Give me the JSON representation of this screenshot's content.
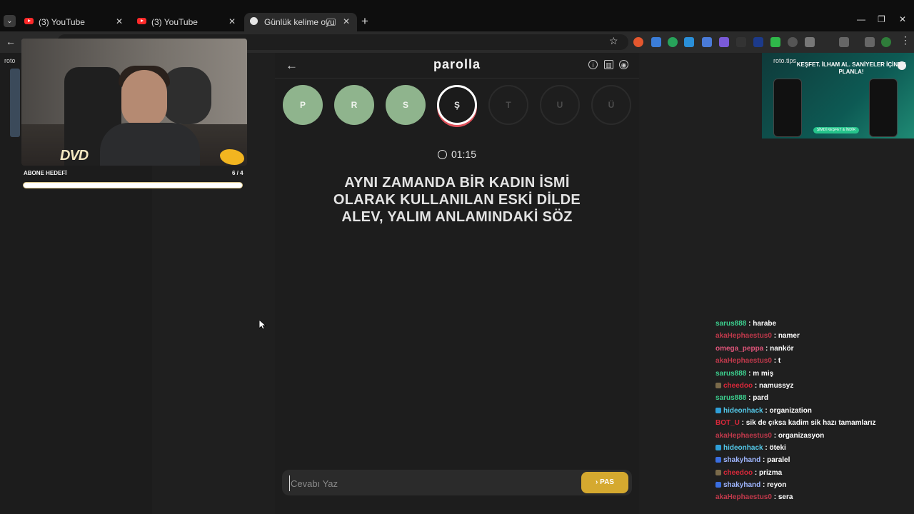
{
  "browser": {
    "tabs": [
      {
        "title": "(3) YouTube",
        "type": "youtube",
        "close": "✕"
      },
      {
        "title": "(3) YouTube",
        "type": "youtube",
        "close": "✕"
      },
      {
        "title": "Günlük kelime oyunu - paro",
        "type": "globe",
        "close": "✕",
        "active": true
      }
    ],
    "new_tab": "+",
    "window_controls": [
      "—",
      "❐",
      "✕"
    ],
    "back_arrow": "←",
    "star": "☆",
    "menu": "⋮",
    "tab_menu_chevron": "⌄"
  },
  "webcam": {
    "dvd_logo_text": "DVD",
    "goal_label": "ABONE HEDEFİ",
    "goal_count": "6 / 4",
    "goal_progress": 1.0
  },
  "left_ad": {
    "label": "roto"
  },
  "right_ad": {
    "label": "roto.tips",
    "title": "KEŞFET. İLHAM AL. SANİYELER İÇİNDE PLANLA!",
    "cta": "ŞİMDİ KEŞFET & İNDİR"
  },
  "game": {
    "back_icon": "←",
    "title": "parolla",
    "icons": [
      "info-icon",
      "stats-icon",
      "profile-icon"
    ],
    "icon_glyphs": [
      "i",
      "▥",
      "◉"
    ],
    "letters": [
      {
        "letter": "P",
        "state": "done"
      },
      {
        "letter": "R",
        "state": "done"
      },
      {
        "letter": "S",
        "state": "done"
      },
      {
        "letter": "Ş",
        "state": "current"
      },
      {
        "letter": "T",
        "state": "pending"
      },
      {
        "letter": "U",
        "state": "pending"
      },
      {
        "letter": "Ü",
        "state": "pending"
      }
    ],
    "timer": "01:15",
    "question": "AYNI ZAMANDA BİR KADIN İSMİ OLARAK KULLANILAN ESKİ DİLDE ALEV, YALIM ANLAMINDAKİ SÖZ",
    "answer_placeholder": "Cevabı Yaz",
    "pass_label": "PAS",
    "pass_icon": "›"
  },
  "chat": [
    {
      "user": "sarus888",
      "msg": "harabe",
      "color": "#3ccf8e",
      "badge": ""
    },
    {
      "user": "akaHephaestus0",
      "msg": "namer",
      "color": "#c0394b",
      "badge": ""
    },
    {
      "user": "omega_peppa",
      "msg": "nankör",
      "color": "#e0557a",
      "badge": ""
    },
    {
      "user": "akaHephaestus0",
      "msg": "t",
      "color": "#c0394b",
      "badge": ""
    },
    {
      "user": "sarus888",
      "msg": "m miş",
      "color": "#3ccf8e",
      "badge": ""
    },
    {
      "user": "cheedoo",
      "msg": "namussyz",
      "color": "#d8283a",
      "badge": "#7a6a4a"
    },
    {
      "user": "sarus888",
      "msg": "pard",
      "color": "#3ccf8e",
      "badge": ""
    },
    {
      "user": "hideonhack",
      "msg": "organization",
      "color": "#54c8e8",
      "badge": "#2f9fd8"
    },
    {
      "user": "BOT_U",
      "msg": "sik de çıksa kadim sik hazı tamamlarız",
      "color": "#d8283a",
      "badge": ""
    },
    {
      "user": "akaHephaestus0",
      "msg": "organizasyon",
      "color": "#c0394b",
      "badge": ""
    },
    {
      "user": "hideonhack",
      "msg": "öteki",
      "color": "#54c8e8",
      "badge": "#2f9fd8"
    },
    {
      "user": "shakyhand",
      "msg": "paralel",
      "color": "#9fb6ff",
      "badge": "#3a6ee0"
    },
    {
      "user": "cheedoo",
      "msg": "prizma",
      "color": "#d8283a",
      "badge": "#7a6a4a"
    },
    {
      "user": "shakyhand",
      "msg": "reyon",
      "color": "#9fb6ff",
      "badge": "#3a6ee0"
    },
    {
      "user": "akaHephaestus0",
      "msg": "sera",
      "color": "#c0394b",
      "badge": ""
    }
  ],
  "colors": {
    "done": "#8fb48d",
    "current_ring": "#ffffff",
    "current_underline": "#e0525c",
    "pass_button": "#d5a92f"
  }
}
